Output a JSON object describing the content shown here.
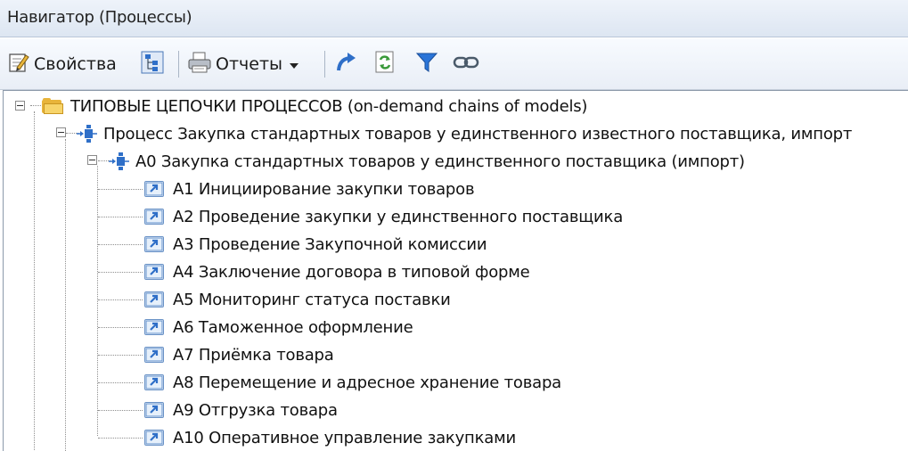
{
  "window": {
    "title": "Навигатор (Процессы)"
  },
  "toolbar": {
    "properties_label": "Свойства",
    "reports_label": "Отчеты"
  },
  "tree": {
    "root": {
      "label": "ТИПОВЫЕ ЦЕПОЧКИ ПРОЦЕССОВ (on-demand chains of models)"
    },
    "process": {
      "label": "Процесс Закупка стандартных товаров у единственного известного поставщика, импорт"
    },
    "a0": {
      "label": "A0 Закупка стандартных товаров у единственного поставщика (импорт)"
    },
    "items": [
      {
        "label": "A1 Инициирование закупки товаров"
      },
      {
        "label": "A2 Проведение закупки у единственного поставщика"
      },
      {
        "label": "A3 Проведение Закупочной комиссии"
      },
      {
        "label": "A4 Заключение договора в типовой форме"
      },
      {
        "label": "A5 Мониторинг статуса поставки"
      },
      {
        "label": "A6 Таможенное оформление"
      },
      {
        "label": "A7 Приёмка товара"
      },
      {
        "label": "A8 Перемещение и адресное хранение товара"
      },
      {
        "label": "A9 Отгрузка товара"
      },
      {
        "label": "A10 Оперативное управление закупками"
      }
    ]
  },
  "icons": {
    "properties": "edit-properties-icon",
    "tree_view": "tree-view-icon",
    "print": "print-icon",
    "dropdown": "chevron-down-icon",
    "redo": "curved-arrow-icon",
    "refresh": "refresh-icon",
    "filter": "filter-icon",
    "link": "chain-link-icon",
    "folder": "folder-icon",
    "process": "process-icon",
    "shortcut": "shortcut-icon"
  },
  "colors": {
    "accent": "#2f6fc8",
    "folder": "#f7d46a",
    "filter": "#2a74d8"
  }
}
